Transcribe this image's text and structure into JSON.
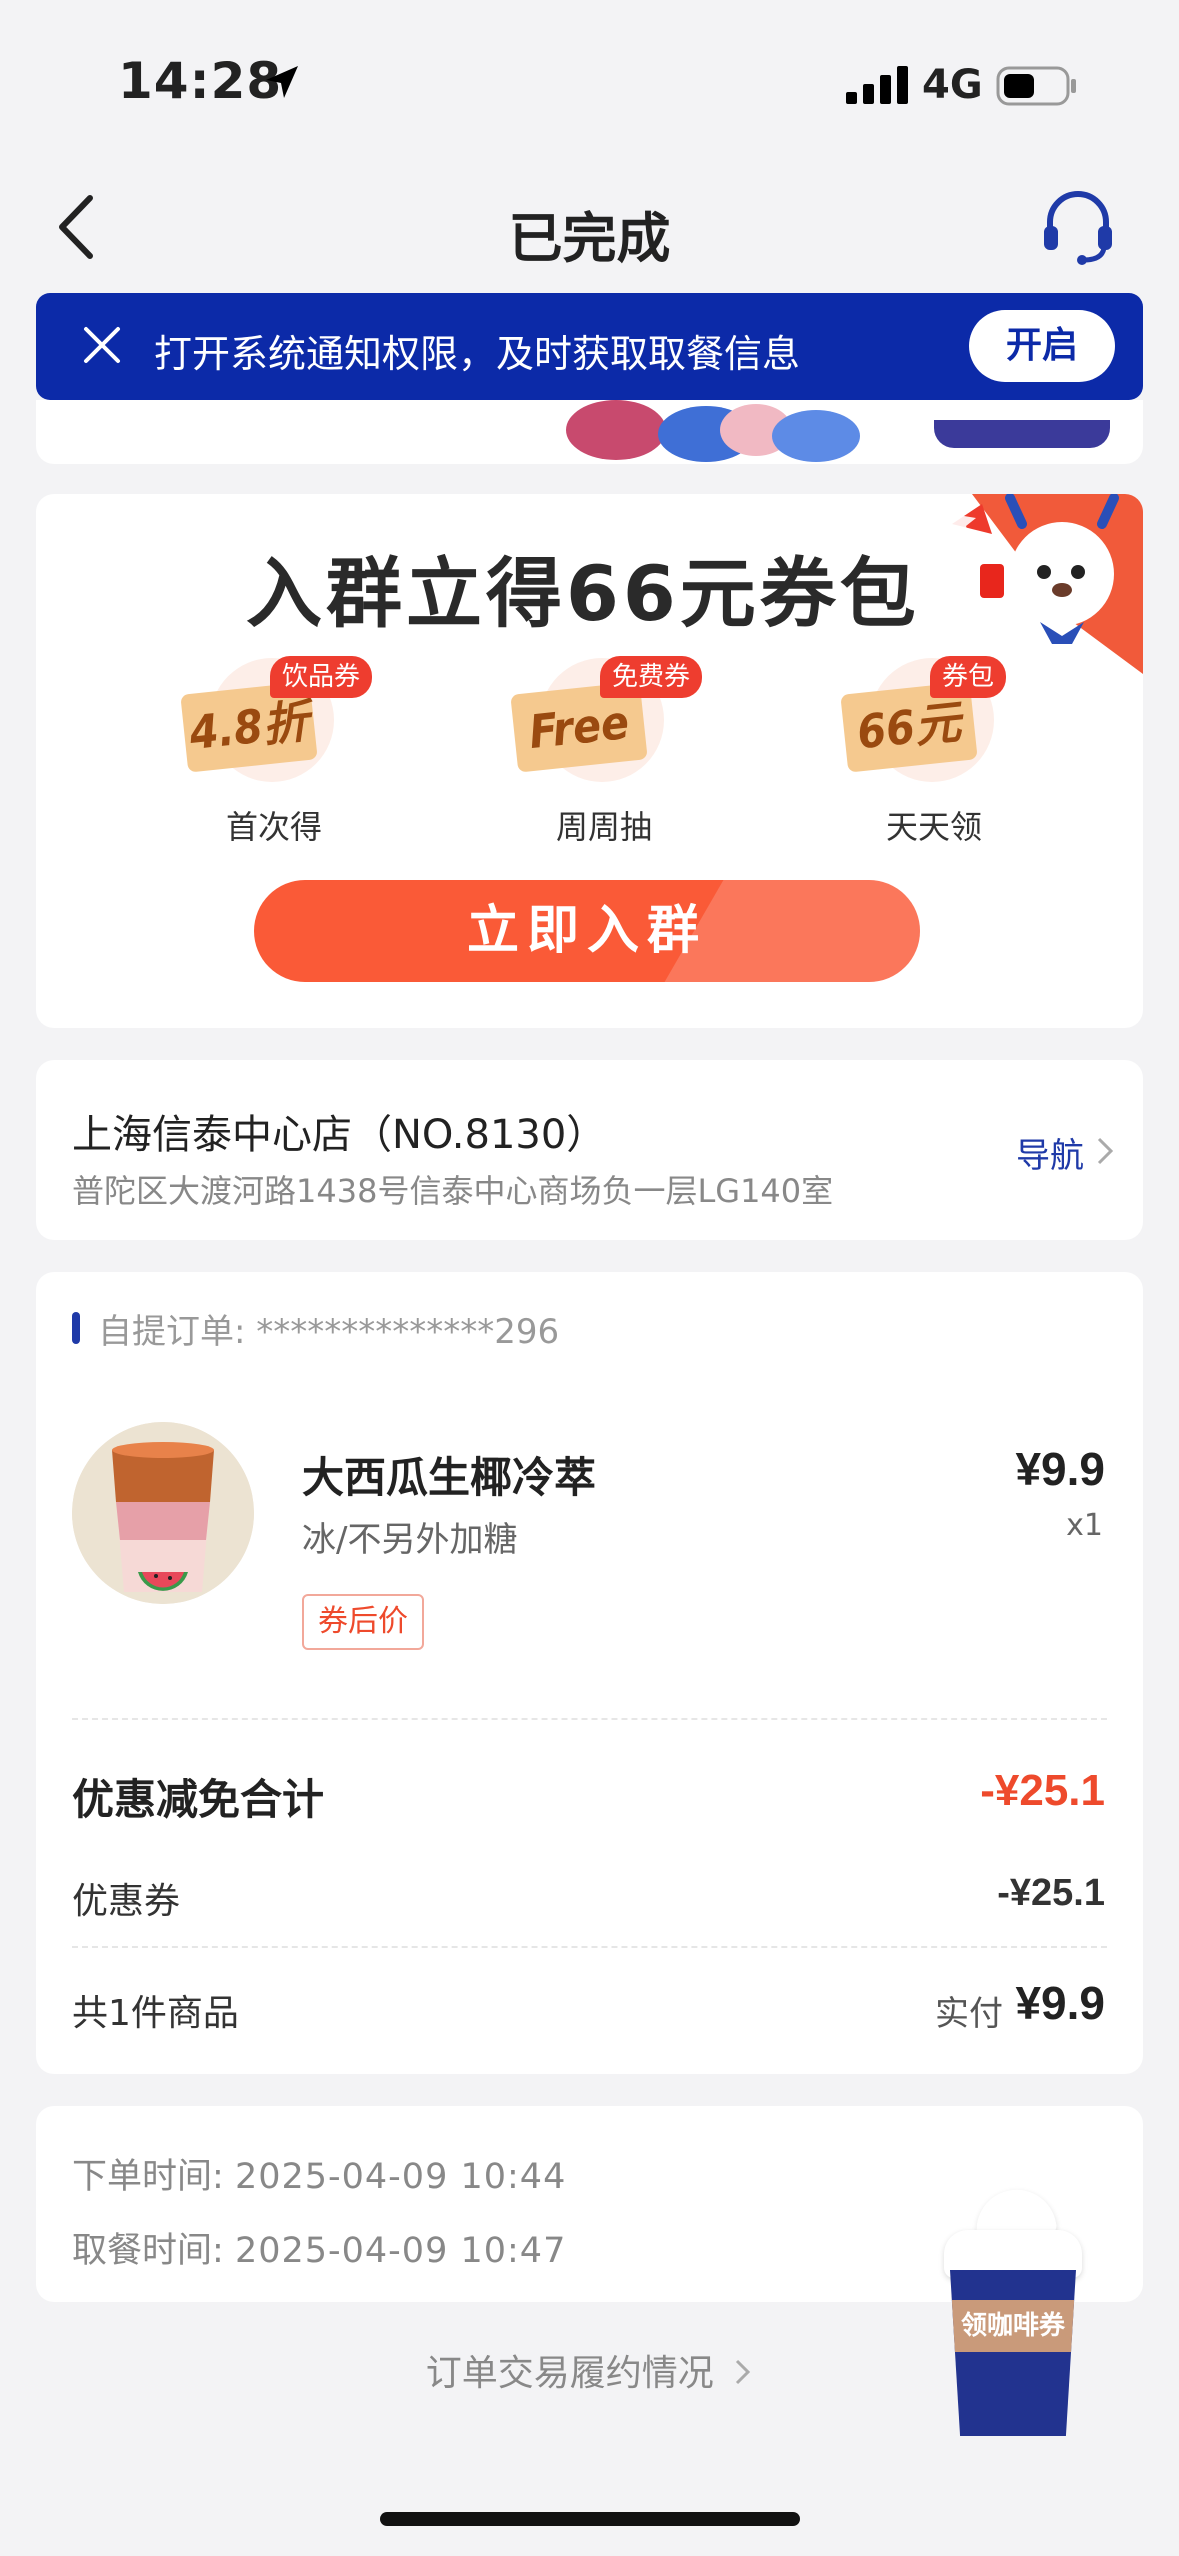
{
  "status_bar": {
    "time": "14:28",
    "network": "4G",
    "icons": [
      "location-arrow-icon",
      "signal-bars-icon",
      "battery-icon"
    ]
  },
  "nav": {
    "title": "已完成",
    "icons": [
      "back-chevron-icon",
      "customer-service-headset-icon"
    ]
  },
  "notification": {
    "text": "打开系统通知权限，及时获取取餐信息",
    "button": "开启",
    "close_icon": "close-icon"
  },
  "promo": {
    "title": "入群立得66元券包",
    "perks": [
      {
        "badge": "饮品券",
        "ticket": "4.8折",
        "label": "首次得"
      },
      {
        "badge": "免费券",
        "ticket": "Free",
        "label": "周周抽"
      },
      {
        "badge": "券包",
        "ticket": "66元",
        "label": "天天领"
      }
    ],
    "button": "立即入群"
  },
  "store": {
    "name": "上海信泰中心店（NO.8130）",
    "address": "普陀区大渡河路1438号信泰中心商场负一层LG140室",
    "nav_link": "导航"
  },
  "order": {
    "order_no": "自提订单: **************296",
    "product": {
      "name": "大西瓜生椰冷萃",
      "spec": "冰/不另外加糖",
      "tag": "券后价",
      "price": "¥9.9",
      "qty": "x1"
    },
    "discount_title": "优惠减免合计",
    "discount_total": "-¥25.1",
    "coupon_label": "优惠券",
    "coupon_value": "-¥25.1",
    "count_label": "共1件商品",
    "paid_label": "实付",
    "paid_value": "¥9.9"
  },
  "times": {
    "order_label": "下单时间:",
    "order_value": "2025-04-09 10:44",
    "pickup_label": "取餐时间:",
    "pickup_value": "2025-04-09 10:47"
  },
  "fulfillment_link": "订单交易履约情况",
  "float_coupon": "领咖啡券",
  "colors": {
    "brand_blue": "#0c2aa8",
    "accent_orange": "#fa5a37",
    "discount_red": "#ee4a2c",
    "background": "#f3f3f5"
  }
}
